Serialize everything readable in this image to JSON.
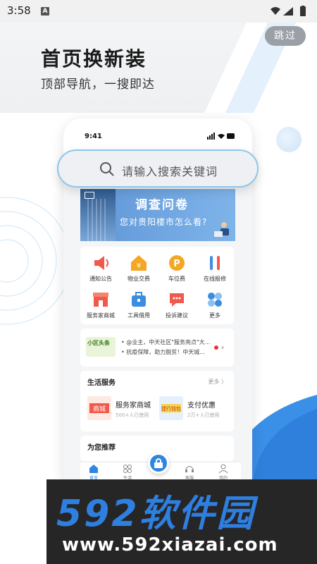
{
  "status_bar": {
    "time": "3:58",
    "notif_glyph": "A",
    "icons": [
      "wifi-icon",
      "signal-icon",
      "battery-icon"
    ]
  },
  "skip_label": "跳过",
  "headline": "首页换新装",
  "subheadline": "顶部导航，一搜即达",
  "phone": {
    "time": "9:41",
    "search_placeholder": "请输入搜索关键词",
    "banner": {
      "title": "调查问卷",
      "subtitle": "您对贵阳楼市怎么看?"
    },
    "services": [
      {
        "label": "通知公告",
        "icon": "speaker-icon",
        "color": "#f05a4a"
      },
      {
        "label": "物业交费",
        "icon": "house-yen-icon",
        "color": "#f5a623"
      },
      {
        "label": "车位费",
        "icon": "parking-coin-icon",
        "color": "#f5a623"
      },
      {
        "label": "在线报修",
        "icon": "tools-icon",
        "color": "#3b8de0"
      },
      {
        "label": "服务家商城",
        "icon": "shop-icon",
        "color": "#f05a4a"
      },
      {
        "label": "工具借用",
        "icon": "toolbox-icon",
        "color": "#3b8de0"
      },
      {
        "label": "投诉建议",
        "icon": "chat-icon",
        "color": "#f05a4a"
      },
      {
        "label": "更多",
        "icon": "more-grid-icon",
        "color": "#3b8de0"
      }
    ],
    "news": {
      "tag": "小区头条",
      "lines": [
        "• @业主，中天社区\"服务亮点\"大...",
        "• 抗疫保障，助力脱贫！中天城..."
      ]
    },
    "life": {
      "title": "生活服务",
      "more": "更多 〉",
      "cards": [
        {
          "name": "服务家商城",
          "meta": "500+人已使用",
          "img_text": "商城"
        },
        {
          "name": "支付优惠",
          "meta": "2万+人已使用",
          "img_text": "建行钱包"
        }
      ]
    },
    "recommend_title": "为您推荐",
    "tabs": [
      {
        "label": "首页",
        "icon": "home-icon"
      },
      {
        "label": "生活",
        "icon": "grid-icon"
      },
      {
        "label": "",
        "icon": "lock-icon"
      },
      {
        "label": "客服",
        "icon": "headset-icon"
      },
      {
        "label": "我的",
        "icon": "user-icon"
      }
    ]
  },
  "watermark": {
    "logo_text": "592软件园",
    "url": "www.592xiazai.com"
  }
}
